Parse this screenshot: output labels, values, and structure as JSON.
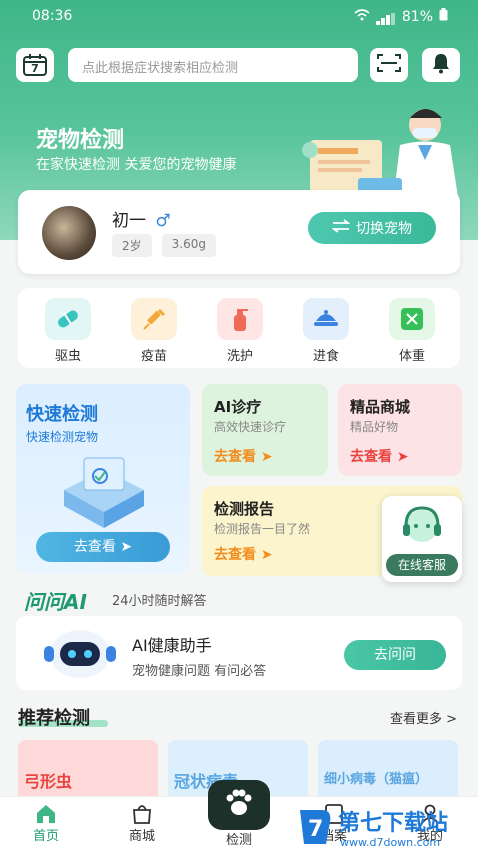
{
  "status_bar": {
    "time": "08:36",
    "battery": "81%"
  },
  "search": {
    "placeholder": "点此根据症状搜索相应检测",
    "calendar_day": "7"
  },
  "hero": {
    "title": "宠物检测",
    "subtitle": "在家快速检测 关爱您的宠物健康"
  },
  "pet": {
    "name": "初一",
    "gender_symbol": "♂",
    "age": "2岁",
    "weight": "3.60g",
    "switch_label": "切换宠物"
  },
  "categories": [
    {
      "label": "驱虫",
      "icon": "pill-icon",
      "bg": "#e3f6f6",
      "fg": "#39c4c0"
    },
    {
      "label": "疫苗",
      "icon": "syringe-icon",
      "bg": "#fff1d9",
      "fg": "#f2a93b"
    },
    {
      "label": "洗护",
      "icon": "shampoo-icon",
      "bg": "#fde6e3",
      "fg": "#ee6b57"
    },
    {
      "label": "进食",
      "icon": "food-bowl-icon",
      "bg": "#e4effc",
      "fg": "#3b83e0"
    },
    {
      "label": "体重",
      "icon": "scale-icon",
      "bg": "#e5f7e6",
      "fg": "#35c05a"
    }
  ],
  "quick_test": {
    "title": "快速检测",
    "subtitle": "快速检测宠物",
    "button": "去查看 ➤"
  },
  "ai_diagnosis": {
    "title": "AI诊疗",
    "subtitle": "高效快速诊疗",
    "link": "去查看 ➤"
  },
  "mall": {
    "title": "精品商城",
    "subtitle": "精品好物",
    "link": "去查看 ➤"
  },
  "report": {
    "title": "检测报告",
    "subtitle": "检测报告一目了然",
    "link": "去查看 ➤"
  },
  "customer_service": {
    "label": "在线客服"
  },
  "ask_ai": {
    "title": "问问AI",
    "subtitle": "24小时随时解答",
    "card_title": "AI健康助手",
    "card_subtitle": "宠物健康问题 有问必答",
    "button": "去问问"
  },
  "recommend": {
    "title": "推荐检测",
    "more": "查看更多 >",
    "items": [
      {
        "label": "弓形虫",
        "bg": "#ffd9d9",
        "fg": "#e8443f"
      },
      {
        "label": "冠状病毒",
        "bg": "#dbeffd",
        "fg": "#5aa6e0"
      },
      {
        "label": "细小病毒（猫瘟）",
        "bg": "#dbeefd",
        "fg": "#5aa6e0"
      }
    ]
  },
  "tabs": [
    {
      "label": "首页",
      "icon": "home-icon",
      "active": true
    },
    {
      "label": "商城",
      "icon": "shop-icon",
      "active": false
    },
    {
      "label": "检测",
      "icon": "paw-icon",
      "active": false
    },
    {
      "label": "档案",
      "icon": "file-icon",
      "active": false
    },
    {
      "label": "我的",
      "icon": "user-icon",
      "active": false
    }
  ],
  "watermark": {
    "text": "第七下载站",
    "url": "www.d7down.com"
  },
  "colors": {
    "brand_green": "#3fb688",
    "accent_orange": "#f28c1b",
    "ai_green": "#1f9a6e"
  }
}
